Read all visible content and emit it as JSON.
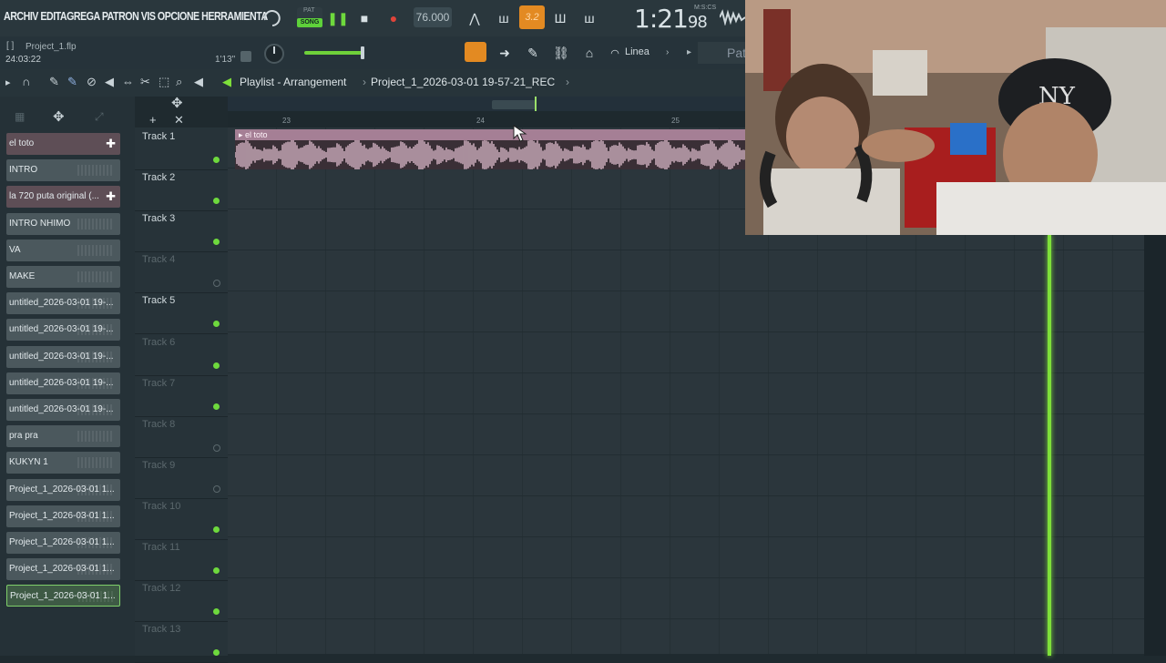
{
  "menu": {
    "text": "ARCHIV EDITAGREGA PATRON VIS OPCIONE HERRAMIENTA"
  },
  "transport": {
    "song_mode_top": "PAT",
    "song_mode": "SONG",
    "tempo": "76.000",
    "snap_value": "3.2",
    "time_main": "1:21",
    "time_frac": "98",
    "time_format": "M:S:CS"
  },
  "project": {
    "file": "Project_1.flp",
    "length": "24:03:22",
    "position": "1'13\""
  },
  "toolbar": {
    "linea_label": "Linea",
    "pat_label": "Pat"
  },
  "playlist": {
    "title": "Playlist - Arrangement",
    "separator": "›",
    "project_name": "Project_1_2026-03-01 19-57-21_REC"
  },
  "ruler": {
    "bars": [
      "23",
      "24",
      "25"
    ]
  },
  "clips": [
    {
      "label": "el toto",
      "style": "pink",
      "plus": "✚"
    },
    {
      "label": "INTRO",
      "style": "grey"
    },
    {
      "label": "la 720 puta original (...",
      "style": "pink",
      "plus": "✚"
    },
    {
      "label": "INTRO NHIMO",
      "style": "grey"
    },
    {
      "label": "VA",
      "style": "grey"
    },
    {
      "label": "MAKE",
      "style": "grey"
    },
    {
      "label": "untitled_2026-03-01 19-...",
      "style": "grey"
    },
    {
      "label": "untitled_2026-03-01 19-...",
      "style": "grey"
    },
    {
      "label": "untitled_2026-03-01 19-...",
      "style": "grey"
    },
    {
      "label": "untitled_2026-03-01 19-...",
      "style": "grey"
    },
    {
      "label": "untitled_2026-03-01 19-...",
      "style": "grey"
    },
    {
      "label": "pra pra",
      "style": "grey"
    },
    {
      "label": "KUKYN 1",
      "style": "grey"
    },
    {
      "label": "Project_1_2026-03-01 1...",
      "style": "grey"
    },
    {
      "label": "Project_1_2026-03-01 1...",
      "style": "grey"
    },
    {
      "label": "Project_1_2026-03-01 1...",
      "style": "grey"
    },
    {
      "label": "Project_1_2026-03-01 1...",
      "style": "grey"
    },
    {
      "label": "Project_1_2026-03-01 1...",
      "style": "green"
    }
  ],
  "tracks": [
    {
      "name": "Track 1",
      "enabled": true
    },
    {
      "name": "Track 2",
      "enabled": true
    },
    {
      "name": "Track 3",
      "enabled": true
    },
    {
      "name": "Track 4",
      "enabled": false
    },
    {
      "name": "Track 5",
      "enabled": true
    },
    {
      "name": "Track 6",
      "enabled": false
    },
    {
      "name": "Track 7",
      "enabled": false
    },
    {
      "name": "Track 8",
      "enabled": false
    },
    {
      "name": "Track 9",
      "enabled": false
    },
    {
      "name": "Track 10",
      "enabled": false
    },
    {
      "name": "Track 11",
      "enabled": false
    },
    {
      "name": "Track 12",
      "enabled": false
    },
    {
      "name": "Track 13",
      "enabled": false
    }
  ],
  "audio_clip": {
    "label": "el toto",
    "arrow": "▸"
  },
  "colors": {
    "accent_orange": "#e38a22",
    "accent_green": "#6ed93d",
    "playhead": "#7ee03a",
    "clip_pink": "#a57f95"
  }
}
